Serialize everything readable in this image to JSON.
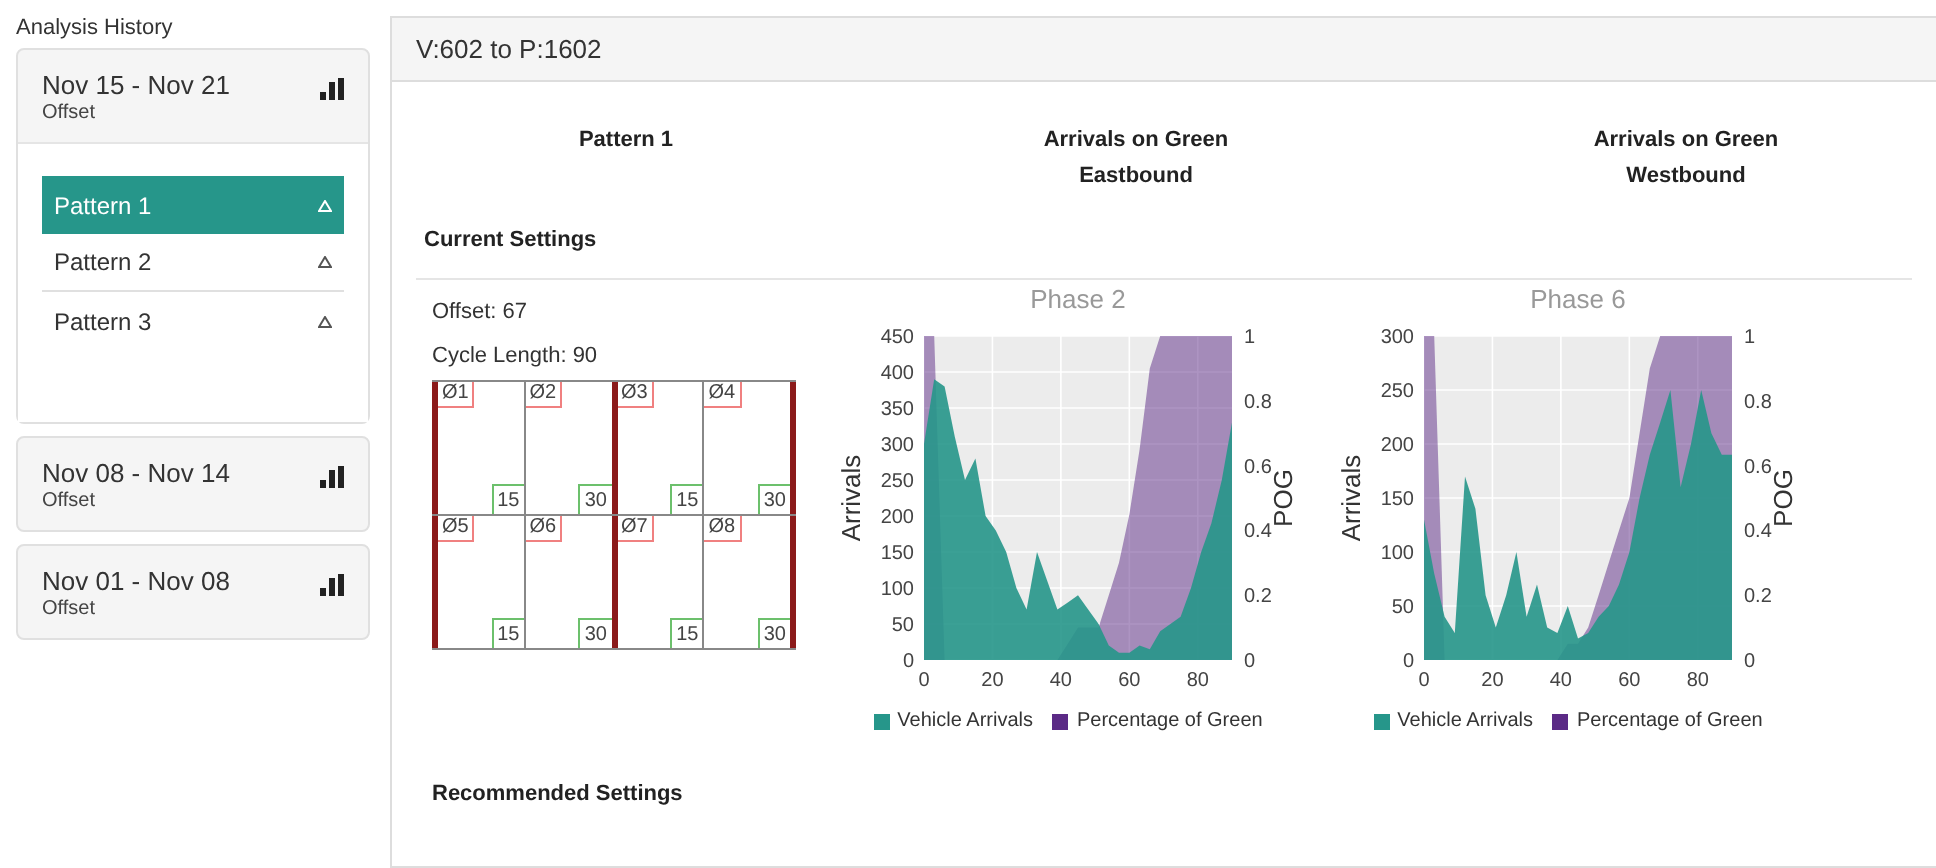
{
  "sidebar": {
    "title": "Analysis History",
    "groups": [
      {
        "dates": "Nov 15 - Nov 21",
        "subtitle": "Offset",
        "expanded": true,
        "patterns": [
          {
            "label": "Pattern 1",
            "selected": true
          },
          {
            "label": "Pattern 2",
            "selected": false
          },
          {
            "label": "Pattern 3",
            "selected": false
          }
        ]
      },
      {
        "dates": "Nov 08 - Nov 14",
        "subtitle": "Offset",
        "expanded": false
      },
      {
        "dates": "Nov 01 - Nov 08",
        "subtitle": "Offset",
        "expanded": false
      }
    ]
  },
  "main": {
    "title": "V:602 to P:1602",
    "columns": [
      {
        "lines": [
          "Pattern 1"
        ]
      },
      {
        "lines": [
          "Arrivals on Green",
          "Eastbound"
        ]
      },
      {
        "lines": [
          "Arrivals on Green",
          "Westbound"
        ]
      }
    ],
    "current_settings": {
      "heading": "Current Settings",
      "offset": "Offset: 67",
      "cycle_length": "Cycle Length: 90",
      "rings": [
        [
          {
            "phase": "Ø1",
            "duration": "15",
            "barrier_left": true,
            "barrier_right": false
          },
          {
            "phase": "Ø2",
            "duration": "30",
            "barrier_left": false,
            "barrier_right": false
          },
          {
            "phase": "Ø3",
            "duration": "15",
            "barrier_left": true,
            "barrier_right": false
          },
          {
            "phase": "Ø4",
            "duration": "30",
            "barrier_left": false,
            "barrier_right": true
          }
        ],
        [
          {
            "phase": "Ø5",
            "duration": "15",
            "barrier_left": true,
            "barrier_right": false
          },
          {
            "phase": "Ø6",
            "duration": "30",
            "barrier_left": false,
            "barrier_right": false
          },
          {
            "phase": "Ø7",
            "duration": "15",
            "barrier_left": true,
            "barrier_right": false
          },
          {
            "phase": "Ø8",
            "duration": "30",
            "barrier_left": false,
            "barrier_right": true
          }
        ]
      ]
    },
    "charts": [
      {
        "chart_data": {
          "type": "area",
          "grid": true,
          "title": "Phase 2",
          "ylabel": "Arrivals",
          "y2label": "POG",
          "x": [
            0,
            3,
            6,
            9,
            12,
            15,
            18,
            21,
            24,
            27,
            30,
            33,
            36,
            39,
            42,
            45,
            48,
            51,
            54,
            57,
            60,
            63,
            66,
            69,
            72,
            75,
            78,
            81,
            84,
            87,
            90
          ],
          "xlim": [
            0,
            90
          ],
          "ylim": [
            0,
            450
          ],
          "y2lim": [
            0,
            1
          ],
          "xticks": [
            0,
            20,
            40,
            60,
            80
          ],
          "yticks": [
            0,
            50,
            100,
            150,
            200,
            250,
            300,
            350,
            400,
            450
          ],
          "y2ticks": [
            0,
            0.2,
            0.4,
            0.6,
            0.8,
            1
          ],
          "series": [
            {
              "name": "Vehicle Arrivals",
              "color": "#26968a",
              "values": [
                300,
                390,
                380,
                310,
                250,
                280,
                200,
                180,
                150,
                100,
                70,
                150,
                110,
                70,
                80,
                90,
                70,
                50,
                20,
                10,
                10,
                20,
                15,
                40,
                50,
                60,
                100,
                150,
                190,
                250,
                330
              ]
            },
            {
              "name": "Percentage of Green",
              "color": "#5b2a86",
              "axis": "y2",
              "values": [
                1,
                1,
                0,
                0,
                0,
                0,
                0,
                0,
                0,
                0,
                0,
                0,
                0,
                0,
                0.05,
                0.1,
                0.1,
                0.1,
                0.2,
                0.3,
                0.45,
                0.65,
                0.9,
                1,
                1,
                1,
                1,
                1,
                1,
                1,
                1
              ]
            }
          ]
        }
      },
      {
        "chart_data": {
          "type": "area",
          "grid": true,
          "title": "Phase 6",
          "ylabel": "Arrivals",
          "y2label": "POG",
          "x": [
            0,
            3,
            6,
            9,
            12,
            15,
            18,
            21,
            24,
            27,
            30,
            33,
            36,
            39,
            42,
            45,
            48,
            51,
            54,
            57,
            60,
            63,
            66,
            69,
            72,
            75,
            78,
            81,
            84,
            87,
            90
          ],
          "xlim": [
            0,
            90
          ],
          "ylim": [
            0,
            300
          ],
          "y2lim": [
            0,
            1
          ],
          "xticks": [
            0,
            20,
            40,
            60,
            80
          ],
          "yticks": [
            0,
            50,
            100,
            150,
            200,
            250,
            300
          ],
          "y2ticks": [
            0,
            0.2,
            0.4,
            0.6,
            0.8,
            1
          ],
          "series": [
            {
              "name": "Vehicle Arrivals",
              "color": "#26968a",
              "values": [
                130,
                80,
                40,
                25,
                170,
                140,
                60,
                30,
                60,
                100,
                40,
                70,
                30,
                25,
                50,
                20,
                25,
                40,
                50,
                70,
                100,
                150,
                190,
                220,
                250,
                160,
                200,
                250,
                210,
                190,
                190
              ]
            },
            {
              "name": "Percentage of Green",
              "color": "#5b2a86",
              "axis": "y2",
              "values": [
                1,
                1,
                0,
                0,
                0,
                0,
                0,
                0,
                0,
                0,
                0,
                0,
                0,
                0,
                0.05,
                0.05,
                0.1,
                0.2,
                0.3,
                0.4,
                0.5,
                0.7,
                0.9,
                1,
                1,
                1,
                1,
                1,
                1,
                1,
                1
              ]
            }
          ]
        }
      }
    ],
    "recommended_settings": {
      "heading": "Recommended Settings"
    }
  }
}
